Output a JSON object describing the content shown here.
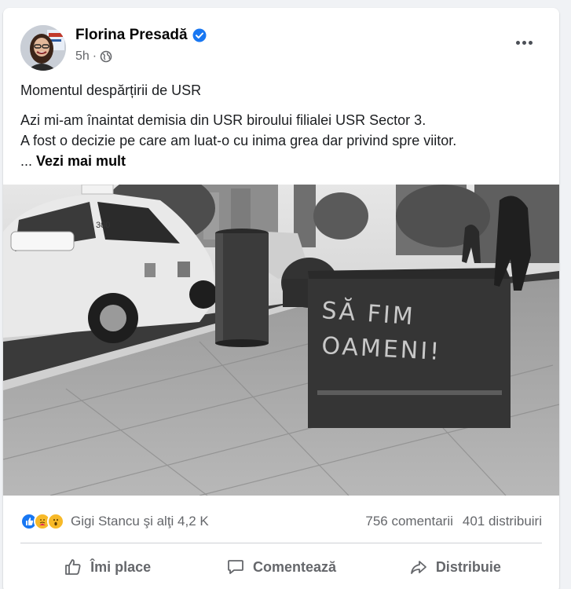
{
  "post": {
    "author": "Florina Presadă",
    "time": "5h",
    "visibility_icon": "globe-icon",
    "title": "Momentul despărțirii de USR",
    "lines": [
      "Azi mi-am înaintat demisia din USR biroului filialei USR Sector 3.",
      "A fost o decizie pe care am luat-o cu inima grea dar privind spre viitor."
    ],
    "see_more_prefix": "... ",
    "see_more": "Vezi mai mult",
    "image_graffiti": "SĂ FIM OAMENI!",
    "image_taxi_number": "300"
  },
  "stats": {
    "reactors": "Gigi Stancu şi alţi 4,2 K",
    "comments": "756 comentarii",
    "shares": "401 distribuiri",
    "reaction_icons": [
      "like-icon",
      "care-icon",
      "wow-icon"
    ]
  },
  "actions": {
    "like": "Îmi place",
    "comment": "Comentează",
    "share": "Distribuie"
  },
  "colors": {
    "accent": "#1877f2",
    "text_secondary": "#65676b",
    "background": "#f0f2f5"
  }
}
